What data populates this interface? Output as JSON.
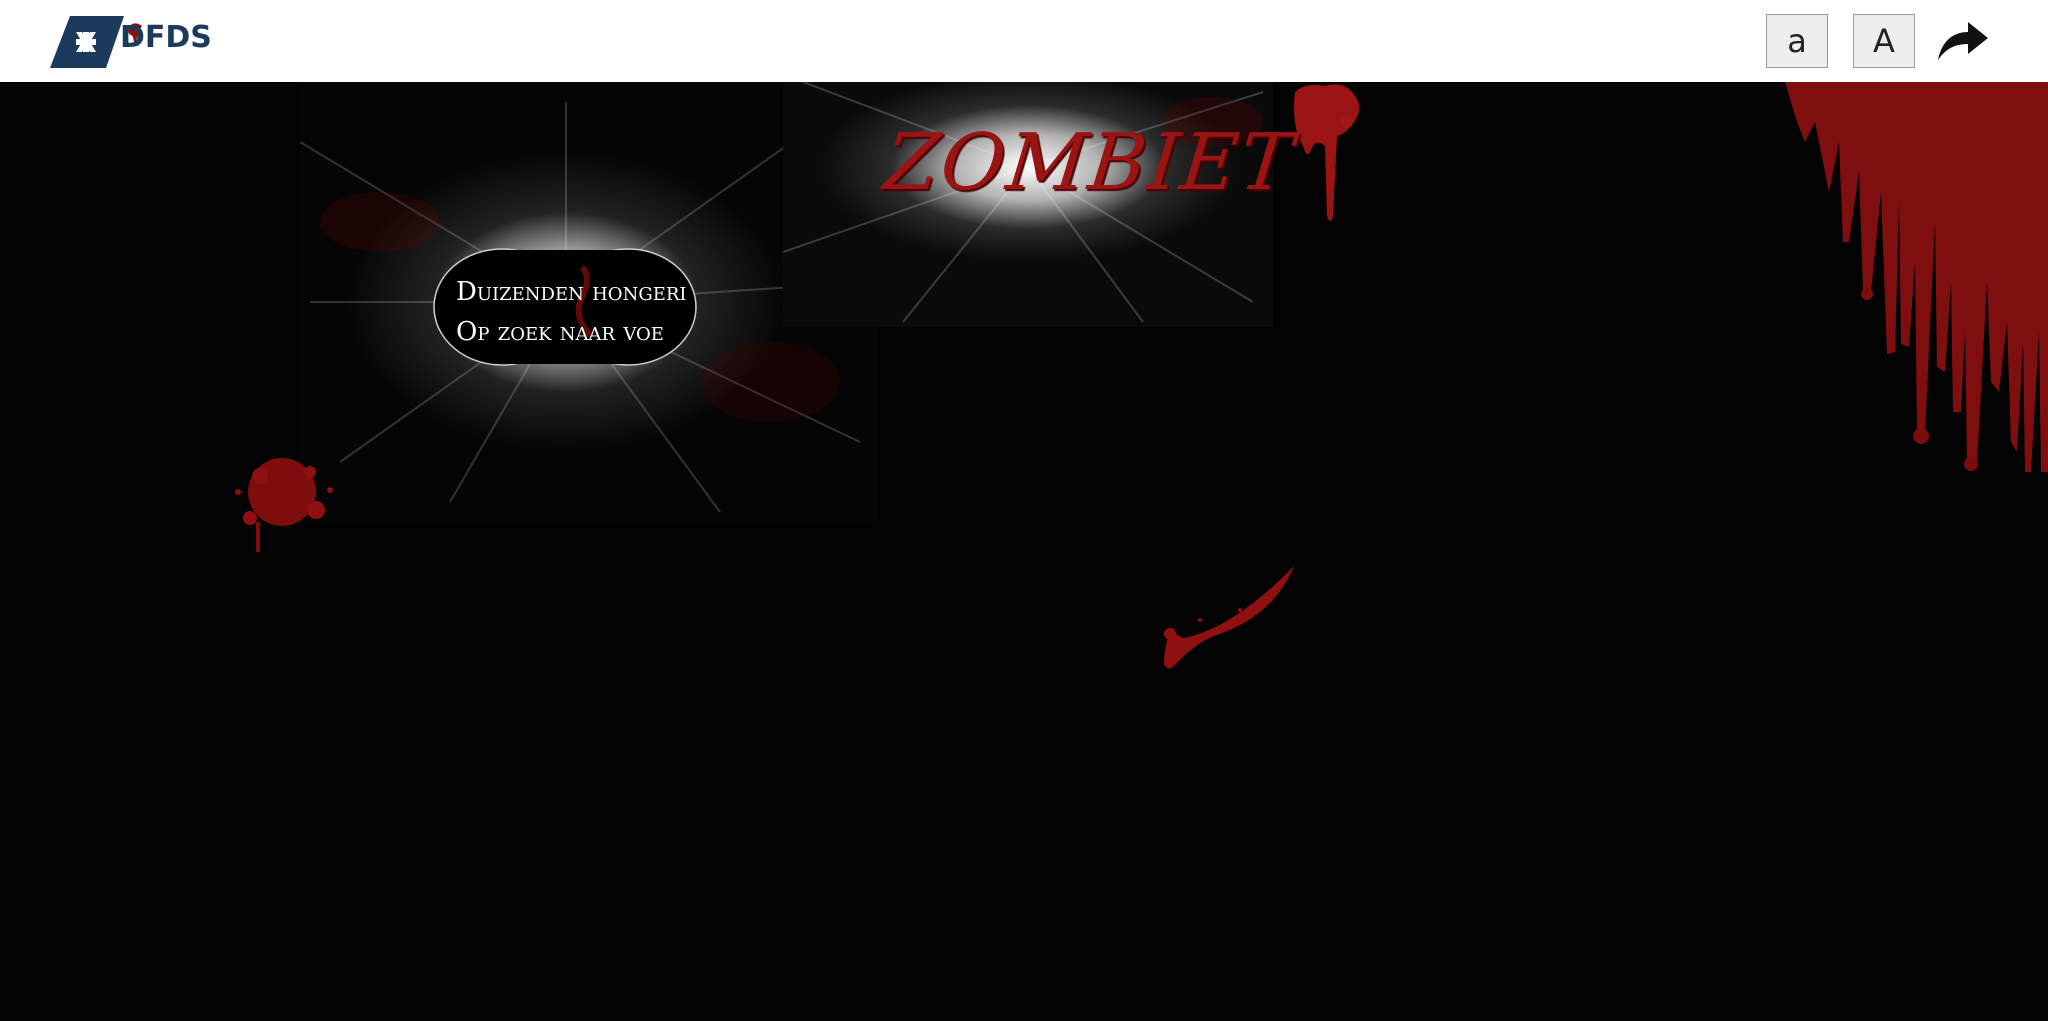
{
  "header": {
    "logo_text": "DFDS",
    "font_small_label": "a",
    "font_large_label": "A",
    "share_icon": "share-arrow-icon"
  },
  "scene": {
    "title": "ZOMBIET",
    "bubble_line1": "Duizenden hongeri",
    "bubble_line2": "Op zoek naar voe"
  },
  "colors": {
    "header_bg": "#ffffff",
    "logo_navy": "#1b3a5c",
    "blood_red": "#9b1414",
    "stage_bg": "#030303"
  }
}
